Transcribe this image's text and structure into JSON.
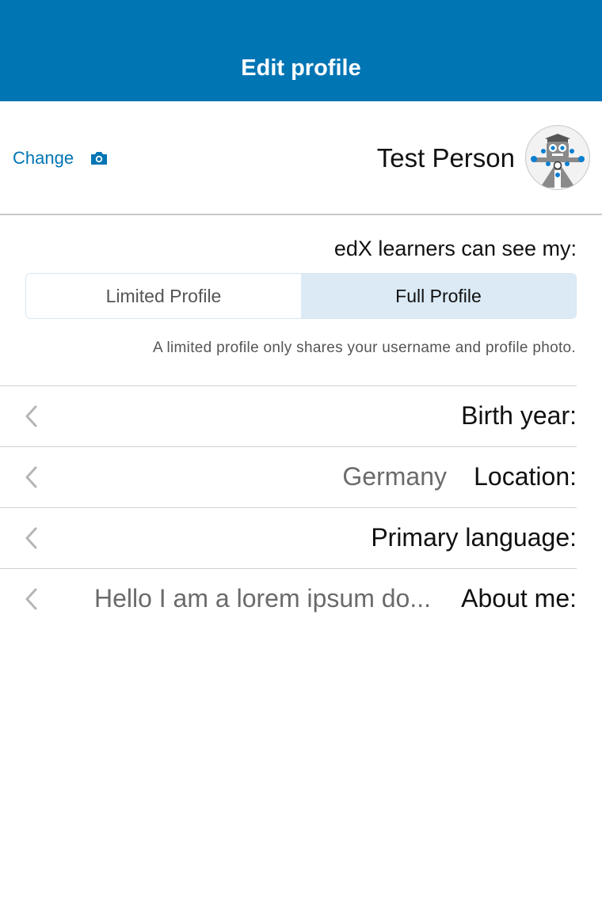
{
  "navbar": {
    "title": "Edit profile"
  },
  "profile_header": {
    "change_label": "Change",
    "camera_icon": "camera-icon",
    "username": "Test Person",
    "avatar_icon": "robot-avatar-icon"
  },
  "visibility": {
    "label": "edX learners can see my:",
    "options": [
      "Limited Profile",
      "Full Profile"
    ],
    "selected": "Full Profile",
    "hint": "A limited profile only shares your username and profile photo."
  },
  "fields": [
    {
      "label": "Birth year:",
      "value": ""
    },
    {
      "label": "Location:",
      "value": "Germany"
    },
    {
      "label": "Primary language:",
      "value": ""
    },
    {
      "label": "About me:",
      "value": "Hello I am a lorem ipsum do..."
    }
  ],
  "colors": {
    "brand": "#0075b4",
    "segment_selected": "#dbeaf5",
    "divider": "#c8c8c8"
  }
}
